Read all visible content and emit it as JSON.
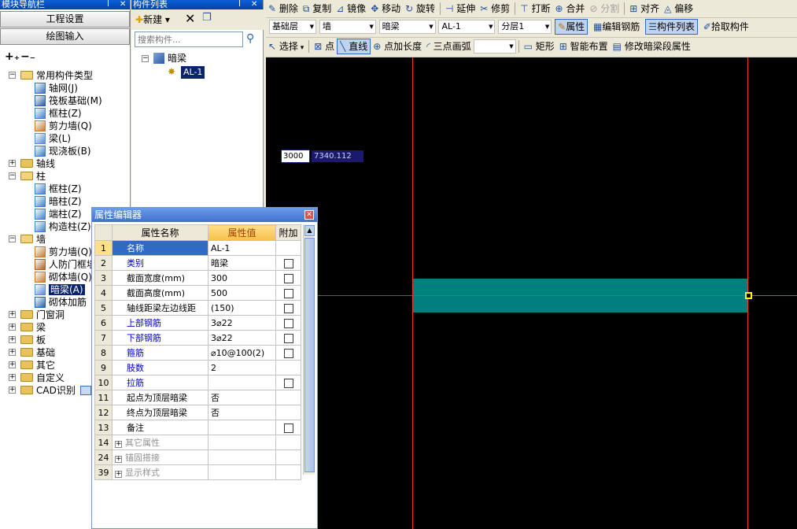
{
  "nav": {
    "title": "模块导航栏",
    "btn_project": "工程设置",
    "btn_draw": "绘图输入",
    "tree": [
      {
        "label": "常用构件类型",
        "level": 0,
        "type": "folder",
        "expanded": true
      },
      {
        "label": "轴网(J)",
        "level": 1,
        "type": "grid"
      },
      {
        "label": "筏板基础(M)",
        "level": 1,
        "type": "raft"
      },
      {
        "label": "框柱(Z)",
        "level": 1,
        "type": "column"
      },
      {
        "label": "剪力墙(Q)",
        "level": 1,
        "type": "wall"
      },
      {
        "label": "梁(L)",
        "level": 1,
        "type": "beam"
      },
      {
        "label": "现浇板(B)",
        "level": 1,
        "type": "slab"
      },
      {
        "label": "轴线",
        "level": 0,
        "type": "folder",
        "expanded": false
      },
      {
        "label": "柱",
        "level": 0,
        "type": "folder",
        "expanded": true
      },
      {
        "label": "框柱(Z)",
        "level": 1,
        "type": "column"
      },
      {
        "label": "暗柱(Z)",
        "level": 1,
        "type": "column"
      },
      {
        "label": "端柱(Z)",
        "level": 1,
        "type": "column"
      },
      {
        "label": "构造柱(Z)",
        "level": 1,
        "type": "column"
      },
      {
        "label": "墙",
        "level": 0,
        "type": "folder",
        "expanded": true
      },
      {
        "label": "剪力墙(Q)",
        "level": 1,
        "type": "wall"
      },
      {
        "label": "人防门框墙",
        "level": 1,
        "type": "door"
      },
      {
        "label": "砌体墙(Q)",
        "level": 1,
        "type": "wall"
      },
      {
        "label": "暗梁(A)",
        "level": 1,
        "type": "beam",
        "selected": true
      },
      {
        "label": "砌体加筋",
        "level": 1,
        "type": "rebar"
      },
      {
        "label": "门窗洞",
        "level": 0,
        "type": "folder",
        "expanded": false
      },
      {
        "label": "梁",
        "level": 0,
        "type": "folder",
        "expanded": false
      },
      {
        "label": "板",
        "level": 0,
        "type": "folder",
        "expanded": false
      },
      {
        "label": "基础",
        "level": 0,
        "type": "folder",
        "expanded": false
      },
      {
        "label": "其它",
        "level": 0,
        "type": "folder",
        "expanded": false
      },
      {
        "label": "自定义",
        "level": 0,
        "type": "folder",
        "expanded": false
      },
      {
        "label": "CAD识别",
        "level": 0,
        "type": "folder",
        "expanded": false
      }
    ]
  },
  "complist": {
    "title": "构件列表",
    "new_label": "新建",
    "search_placeholder": "搜索构件...",
    "group": "暗梁",
    "item": "AL-1"
  },
  "toolbar1": [
    "删除",
    "复制",
    "镜像",
    "移动",
    "旋转",
    "延伸",
    "修剪",
    "打断",
    "合并",
    "分割",
    "对齐",
    "偏移"
  ],
  "toolbar2": {
    "floor": "基础层",
    "category": "墙",
    "type": "暗梁",
    "component": "AL-1",
    "layer": "分层1",
    "props": "属性",
    "edit_rebar": "编辑钢筋",
    "comp_list": "构件列表",
    "pick": "拾取构件"
  },
  "toolbar3": [
    "选择",
    "点",
    "直线",
    "点加长度",
    "三点画弧",
    "矩形",
    "智能布置",
    "修改暗梁段属性"
  ],
  "canvas": {
    "input_len": "3000",
    "coord": "7340.112"
  },
  "prop_editor": {
    "title": "属性编辑器",
    "col_name": "属性名称",
    "col_value": "属性值",
    "col_extra": "附加",
    "rows": [
      {
        "n": "1",
        "name": "名称",
        "value": "AL-1",
        "cb": false,
        "blue": false,
        "selected": true
      },
      {
        "n": "2",
        "name": "类别",
        "value": "暗梁",
        "cb": true,
        "blue": true
      },
      {
        "n": "3",
        "name": "截面宽度(mm)",
        "value": "300",
        "cb": true,
        "blue": false
      },
      {
        "n": "4",
        "name": "截面高度(mm)",
        "value": "500",
        "cb": true,
        "blue": false
      },
      {
        "n": "5",
        "name": "轴线距梁左边线距",
        "value": "(150)",
        "cb": true,
        "blue": false
      },
      {
        "n": "6",
        "name": "上部钢筋",
        "value": "3⌀22",
        "cb": true,
        "blue": true
      },
      {
        "n": "7",
        "name": "下部钢筋",
        "value": "3⌀22",
        "cb": true,
        "blue": true
      },
      {
        "n": "8",
        "name": "箍筋",
        "value": "⌀10@100(2)",
        "cb": true,
        "blue": true
      },
      {
        "n": "9",
        "name": "肢数",
        "value": "2",
        "cb": false,
        "blue": true
      },
      {
        "n": "10",
        "name": "拉筋",
        "value": "",
        "cb": true,
        "blue": true
      },
      {
        "n": "11",
        "name": "起点为顶层暗梁",
        "value": "否",
        "cb": false,
        "blue": false
      },
      {
        "n": "12",
        "name": "终点为顶层暗梁",
        "value": "否",
        "cb": false,
        "blue": false
      },
      {
        "n": "13",
        "name": "备注",
        "value": "",
        "cb": true,
        "blue": false
      },
      {
        "n": "14",
        "name": "其它属性",
        "value": "",
        "cb": false,
        "blue": false,
        "group": true
      },
      {
        "n": "24",
        "name": "锚固搭接",
        "value": "",
        "cb": false,
        "blue": false,
        "group": true
      },
      {
        "n": "39",
        "name": "显示样式",
        "value": "",
        "cb": false,
        "blue": false,
        "group": true
      }
    ]
  }
}
